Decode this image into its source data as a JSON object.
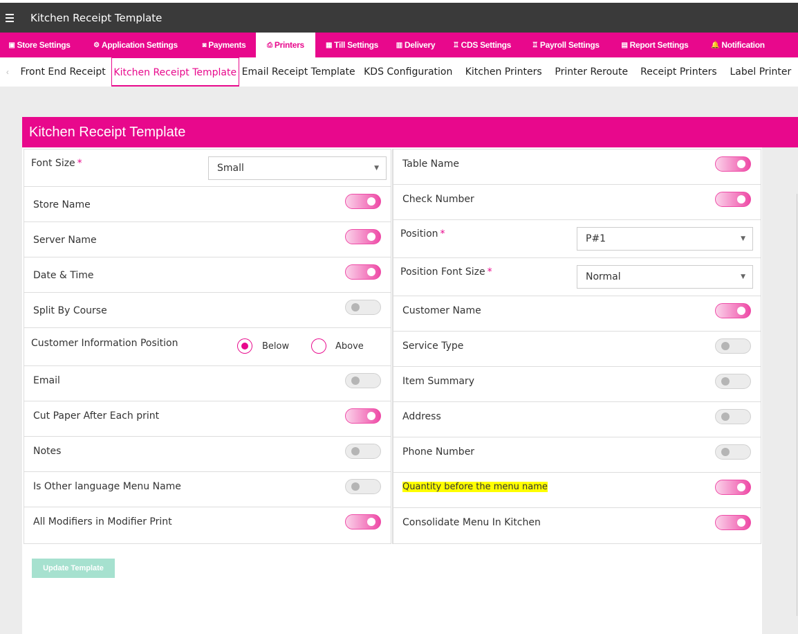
{
  "topbar": {
    "title": "Kitchen Receipt Template"
  },
  "main_nav": [
    {
      "label": "Store Settings",
      "icon": "store-icon",
      "glyph": "▣"
    },
    {
      "label": "Application Settings",
      "icon": "gears-icon",
      "glyph": "⚙"
    },
    {
      "label": "Payments",
      "icon": "money-icon",
      "glyph": "◙"
    },
    {
      "label": "Printers",
      "icon": "printer-icon",
      "glyph": "⎙"
    },
    {
      "label": "Till Settings",
      "icon": "till-icon",
      "glyph": "▦"
    },
    {
      "label": "Delivery",
      "icon": "delivery-icon",
      "glyph": "▥"
    },
    {
      "label": "CDS Settings",
      "icon": "display-icon",
      "glyph": "♖"
    },
    {
      "label": "Payroll Settings",
      "icon": "payroll-icon",
      "glyph": "♖"
    },
    {
      "label": "Report Settings",
      "icon": "report-icon",
      "glyph": "▤"
    },
    {
      "label": "Notification",
      "icon": "bell-icon",
      "glyph": "🔔"
    }
  ],
  "sub_nav": [
    {
      "label": "Front End Receipt"
    },
    {
      "label": "Kitchen Receipt Template"
    },
    {
      "label": "Email Receipt Template"
    },
    {
      "label": "KDS Configuration"
    },
    {
      "label": "Kitchen Printers"
    },
    {
      "label": "Printer Reroute"
    },
    {
      "label": "Receipt Printers"
    },
    {
      "label": "Label Printer"
    }
  ],
  "panel": {
    "title": "Kitchen Receipt Template"
  },
  "left": {
    "font_size": {
      "label": "Font Size",
      "value": "Small"
    },
    "store_name": {
      "label": "Store Name",
      "on": true
    },
    "server_name": {
      "label": "Server Name",
      "on": true
    },
    "date_time": {
      "label": "Date & Time",
      "on": true
    },
    "split_by_course": {
      "label": "Split By Course",
      "on": false
    },
    "customer_info_position": {
      "label": "Customer Information Position",
      "below": "Below",
      "above": "Above",
      "selected": "Below"
    },
    "email": {
      "label": "Email",
      "on": false
    },
    "cut_paper": {
      "label": "Cut Paper After Each print",
      "on": true
    },
    "notes": {
      "label": "Notes",
      "on": false
    },
    "other_language": {
      "label": "Is Other language Menu Name",
      "on": false
    },
    "all_modifiers": {
      "label": "All Modifiers in Modifier Print",
      "on": true
    }
  },
  "right": {
    "table_name": {
      "label": "Table Name",
      "on": true
    },
    "check_number": {
      "label": "Check Number",
      "on": true
    },
    "position": {
      "label": "Position",
      "value": "P#1"
    },
    "position_font_size": {
      "label": "Position Font Size",
      "value": "Normal"
    },
    "customer_name": {
      "label": "Customer Name",
      "on": true
    },
    "service_type": {
      "label": "Service Type",
      "on": false
    },
    "item_summary": {
      "label": "Item Summary",
      "on": false
    },
    "address": {
      "label": "Address",
      "on": false
    },
    "phone_number": {
      "label": "Phone Number",
      "on": false
    },
    "quantity_before": {
      "label": "Quantity before the menu name",
      "on": true
    },
    "consolidate_menu": {
      "label": "Consolidate Menu In Kitchen",
      "on": true
    }
  },
  "update_button": {
    "label": "Update Template"
  },
  "colors": {
    "accent": "#e8088c",
    "topbar": "#3a3a3a",
    "button": "#a6e1cf"
  }
}
